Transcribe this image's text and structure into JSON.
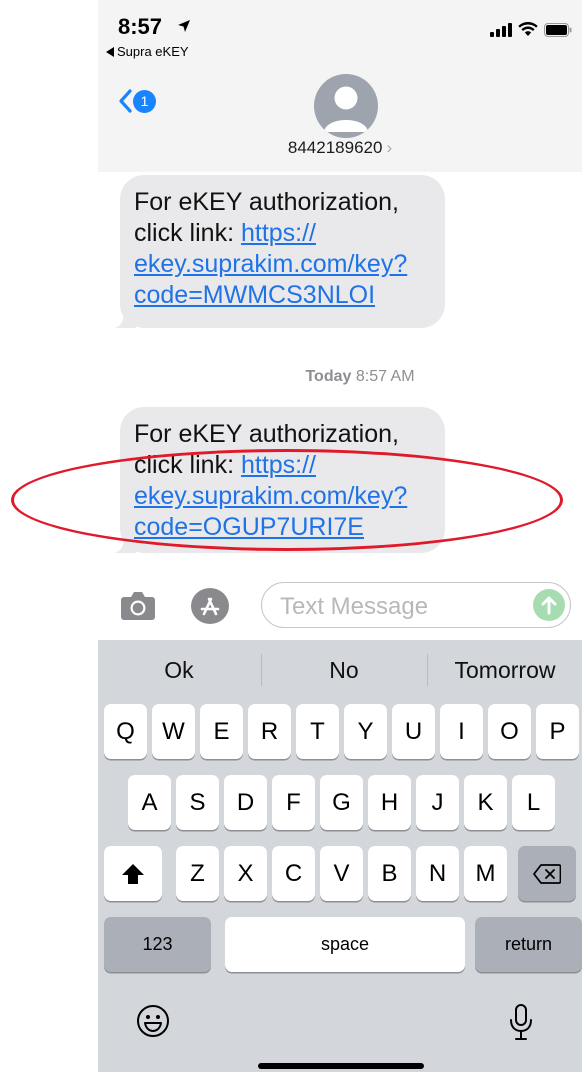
{
  "status_bar": {
    "time": "8:57",
    "back_app": "Supra eKEY"
  },
  "nav": {
    "badge_count": "1",
    "contact": "8442189620",
    "contact_chevron": "›"
  },
  "messages": [
    {
      "line1": "For eKEY authorization,",
      "line2_prefix": "click link: ",
      "link_parts": [
        "https://",
        "ekey.suprakim.com/key?",
        "code=MWMCS3NLOI"
      ]
    },
    {
      "line1": "For eKEY authorization,",
      "line2_prefix": "click link: ",
      "link_parts": [
        "https://",
        "ekey.suprakim.com/key?",
        "code=OGUP7URI7E"
      ]
    }
  ],
  "timestamp": {
    "day": "Today",
    "time": "8:57 AM"
  },
  "input": {
    "placeholder": "Text Message"
  },
  "keyboard": {
    "suggestions": [
      "Ok",
      "No",
      "Tomorrow"
    ],
    "row1": [
      "Q",
      "W",
      "E",
      "R",
      "T",
      "Y",
      "U",
      "I",
      "O",
      "P"
    ],
    "row2": [
      "A",
      "S",
      "D",
      "F",
      "G",
      "H",
      "J",
      "K",
      "L"
    ],
    "row3": [
      "Z",
      "X",
      "C",
      "V",
      "B",
      "N",
      "M"
    ],
    "numbers_label": "123",
    "space_label": "space",
    "return_label": "return"
  },
  "colors": {
    "link": "#1f73e6",
    "badge": "#1a84ff",
    "annotation": "#e0192b",
    "send": "#a6dcb0"
  }
}
